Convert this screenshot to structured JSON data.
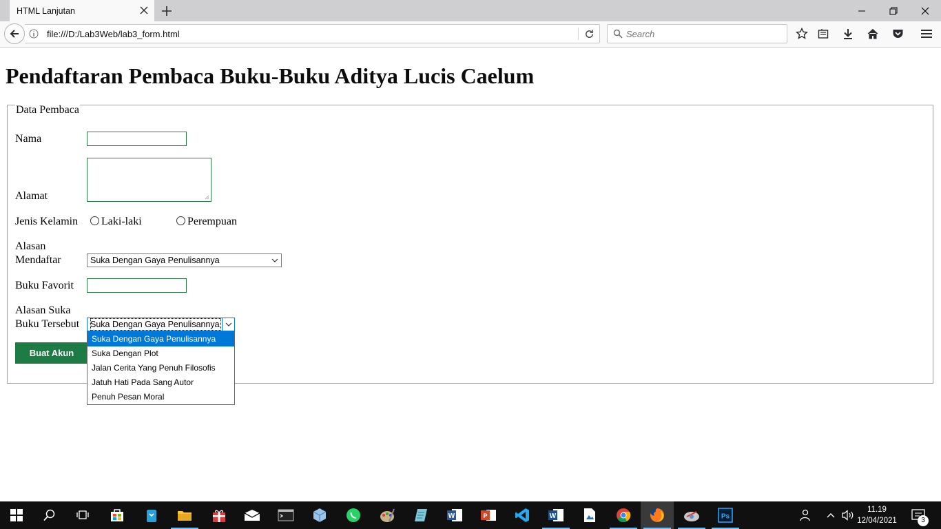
{
  "browser": {
    "tab_title": "HTML Lanjutan",
    "url": "file:///D:/Lab3Web/lab3_form.html",
    "search_placeholder": "Search"
  },
  "page": {
    "heading": "Pendaftaran Pembaca Buku-Buku Aditya Lucis Caelum",
    "fieldset_legend": "Data Pembaca",
    "labels": {
      "nama": "Nama",
      "alamat": "Alamat",
      "jenis_kelamin": "Jenis Kelamin",
      "alasan_mendaftar_1": "Alasan",
      "alasan_mendaftar_2": "Mendaftar",
      "buku_favorit": "Buku Favorit",
      "alasan_suka_1": "Alasan Suka",
      "alasan_suka_2": "Buku Tersebut"
    },
    "fields": {
      "nama_value": "",
      "alamat_value": "",
      "buku_favorit_value": ""
    },
    "gender_options": [
      "Laki-laki",
      "Perempuan"
    ],
    "alasan_mendaftar_selected": "Suka Dengan Gaya Penulisannya",
    "alasan_suka_selected": "Suka Dengan Gaya Penulisannya",
    "alasan_suka_options": [
      "Suka Dengan Gaya Penulisannya",
      "Suka Dengan Plot",
      "Jalan Cerita Yang Penuh Filosofis",
      "Jatuh Hati Pada Sang Autor",
      "Penuh Pesan Moral"
    ],
    "submit_label": "Buat Akun"
  },
  "taskbar": {
    "time": "11.19",
    "date": "12/04/2021",
    "notification_count": "3",
    "apps": [
      "start-icon",
      "search-icon",
      "task-view-icon",
      "store-icon",
      "bag-icon",
      "file-explorer-icon",
      "gift-icon",
      "mail-icon",
      "terminal-icon",
      "box-icon",
      "whatsapp-icon",
      "paint-icon",
      "notes-icon",
      "word-icon",
      "office-icon",
      "vscode-icon",
      "word2-icon",
      "photo-icon",
      "chrome-icon",
      "firefox-icon",
      "remote-icon",
      "photoshop-icon"
    ]
  }
}
